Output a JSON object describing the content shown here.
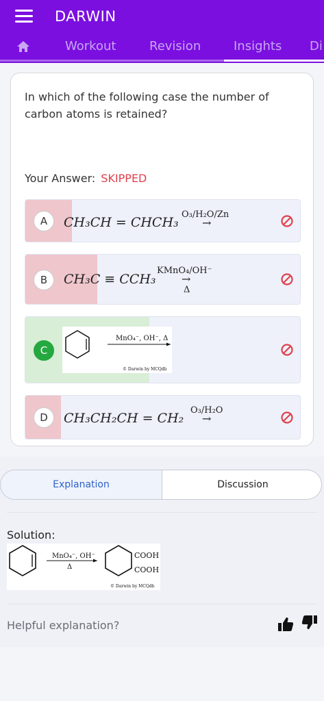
{
  "app": {
    "title": "DARWIN"
  },
  "tabs": [
    "Workout",
    "Revision",
    "Insights",
    "Di"
  ],
  "question": {
    "text": "In which of the following case the number of carbon atoms is retained?",
    "your_answer_label": "Your Answer:",
    "your_answer_value": "SKIPPED"
  },
  "options": [
    {
      "letter": "A",
      "reactant": "CH₃CH = CHCH₃",
      "reagent": "O₃/H₂O/Zn",
      "arrow": "→",
      "below": ""
    },
    {
      "letter": "B",
      "reactant": "CH₃C ≡ CCH₃",
      "reagent": "KMnO₄/OH⁻",
      "arrow": "→",
      "below": "Δ"
    },
    {
      "letter": "C",
      "reactant": "",
      "reagent": "MnO₄⁻, OH⁻, Δ",
      "arrow": "",
      "below": "",
      "image_caption": "© Darwin by MCQdb"
    },
    {
      "letter": "D",
      "reactant": "CH₃CH₂CH = CH₂",
      "reagent": "O₃/H₂O",
      "arrow": "→",
      "below": ""
    }
  ],
  "segments": {
    "explanation": "Explanation",
    "discussion": "Discussion"
  },
  "solution": {
    "label": "Solution:",
    "reagent": "MnO₄⁻, OH⁻",
    "reagent_below": "Δ",
    "product_top": "COOH",
    "product_bottom": "COOH",
    "caption": "© Darwin by MCQdb"
  },
  "feedback": {
    "prompt": "Helpful explanation?"
  },
  "icons": {
    "menu": "hamburger-icon",
    "home": "home-icon",
    "status": "not-allowed-icon",
    "like": "thumbs-up-icon",
    "dislike": "thumbs-down-icon"
  },
  "colors": {
    "appbar": "#7b0fe0",
    "wrong": "#e0404c",
    "correct": "#25a83f",
    "skipped": "#e0404c",
    "link": "#2f62c6"
  }
}
